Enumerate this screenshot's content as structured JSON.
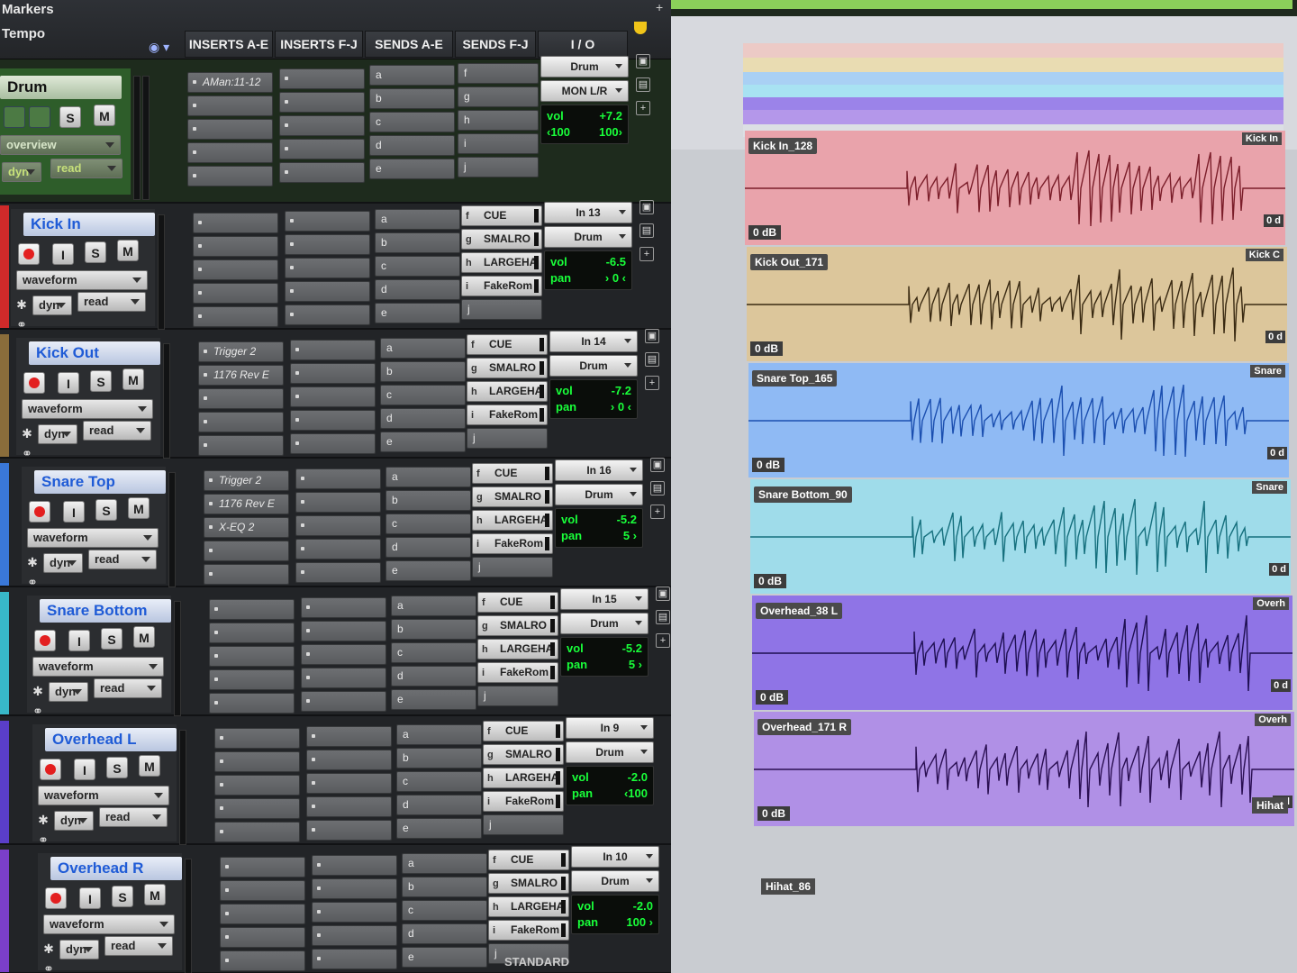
{
  "top": {
    "markers": "Markers",
    "tempo": "Tempo"
  },
  "headers": {
    "inserts_ae": "INSERTS A-E",
    "inserts_fj": "INSERTS F-J",
    "sends_ae": "SENDS A-E",
    "sends_fj": "SENDS F-J",
    "io": "I / O"
  },
  "master": {
    "name": "Drum",
    "s": "S",
    "m": "M",
    "view": "overview",
    "dyn": "dyn",
    "read": "read",
    "insert": "AMan:11-12",
    "io_in": "Drum",
    "io_out": "MON L/R",
    "vol_label": "vol",
    "vol": "+7.2",
    "pan_l": "‹100",
    "pan_r": "100›"
  },
  "tracks": [
    {
      "name": "Kick In",
      "color": "#cf2a2a",
      "inserts": [
        "",
        "",
        "",
        "",
        ""
      ],
      "io_in": "In 13",
      "io_out": "Drum",
      "vol": "-6.5",
      "pan": "› 0 ‹"
    },
    {
      "name": "Kick Out",
      "color": "#8a6d3b",
      "inserts": [
        "Trigger 2",
        "1176 Rev E",
        "",
        "",
        ""
      ],
      "io_in": "In 14",
      "io_out": "Drum",
      "vol": "-7.2",
      "pan": "› 0 ‹"
    },
    {
      "name": "Snare Top",
      "color": "#3a78d9",
      "inserts": [
        "Trigger 2",
        "1176 Rev E",
        "X-EQ 2",
        "",
        ""
      ],
      "io_in": "In 16",
      "io_out": "Drum",
      "vol": "-5.2",
      "pan": "5 ›"
    },
    {
      "name": "Snare Bottom",
      "color": "#38b8c8",
      "inserts": [
        "",
        "",
        "",
        "",
        ""
      ],
      "io_in": "In 15",
      "io_out": "Drum",
      "vol": "-5.2",
      "pan": "5 ›"
    },
    {
      "name": "Overhead L",
      "color": "#5a3ec9",
      "inserts": [
        "",
        "",
        "",
        "",
        ""
      ],
      "io_in": "In 9",
      "io_out": "Drum",
      "vol": "-2.0",
      "pan": "‹100"
    },
    {
      "name": "Overhead R",
      "color": "#7b3fc9",
      "inserts": [
        "",
        "",
        "",
        "",
        ""
      ],
      "io_in": "In 10",
      "io_out": "Drum",
      "vol": "-2.0",
      "pan": "100 ›"
    }
  ],
  "strip_common": {
    "i": "I",
    "s": "S",
    "m": "M",
    "view": "waveform",
    "dyn": "dyn",
    "read": "read",
    "vol_label": "vol",
    "pan_label": "pan"
  },
  "sends_letters_ae": [
    "a",
    "b",
    "c",
    "d",
    "e"
  ],
  "sends_letters_fj": [
    "f",
    "g",
    "h",
    "i",
    "j"
  ],
  "sends_fj_names": [
    "CUE",
    "SMALRO",
    "LARGEHA",
    "FakeRom"
  ],
  "clips": [
    {
      "title": "Kick In_128",
      "tag": "Kick In",
      "db": "0 dB",
      "db2": "0 d",
      "color": "#e9a3ab",
      "wave": "#7b1e2a"
    },
    {
      "title": "Kick Out_171",
      "tag": "Kick C",
      "db": "0 dB",
      "db2": "0 d",
      "color": "#dcc69b",
      "wave": "#3a2a12"
    },
    {
      "title": "Snare Top_165",
      "tag": "Snare",
      "db": "0 dB",
      "db2": "0 d",
      "color": "#8fbaf4",
      "wave": "#1b4fb0"
    },
    {
      "title": "Snare Bottom_90",
      "tag": "Snare",
      "db": "0 dB",
      "db2": "0 d",
      "color": "#9fdcea",
      "wave": "#16707e"
    },
    {
      "title": "Overhead_38 L",
      "tag": "Overh",
      "db": "0 dB",
      "db2": "0 d",
      "color": "#8f74e6",
      "wave": "#1e0f52"
    },
    {
      "title": "Overhead_171 R",
      "tag": "Overh",
      "db": "0 dB",
      "db2": "0 d",
      "color": "#b090e6",
      "wave": "#2a0f52"
    }
  ],
  "hihat_clip": "Hihat_86",
  "hihat_tag": "Hihat",
  "bottom_text": "STANDARD",
  "dock": [
    "spotify-icon",
    "tweak-icon",
    "pro-tools-icon",
    "logic-icon"
  ]
}
